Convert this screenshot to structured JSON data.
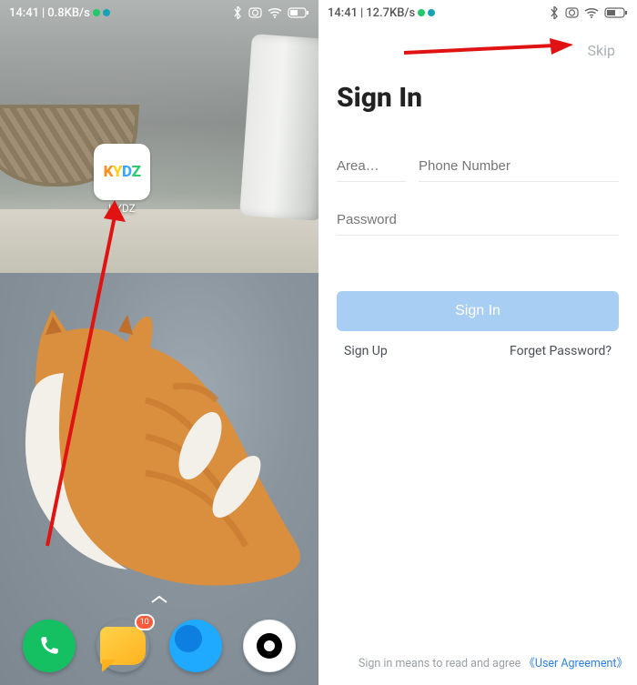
{
  "left": {
    "status": {
      "time": "14:41",
      "speed": "0.8KB/s"
    },
    "app": {
      "logo_letters": [
        "K",
        "Y",
        "D",
        "Z"
      ],
      "label": "KYDZ"
    },
    "dock": {
      "msg_badge": "10"
    },
    "pager_glyph": "^"
  },
  "right": {
    "status": {
      "time": "14:41",
      "speed": "12.7KB/s"
    },
    "skip": "Skip",
    "title": "Sign In",
    "area_placeholder": "Area…",
    "phone_placeholder": "Phone Number",
    "password_placeholder": "Password",
    "submit": "Sign In",
    "signup": "Sign Up",
    "forget": "Forget Password?",
    "agree_text": "Sign in means to read and agree",
    "agree_link": "《User Agreement》"
  }
}
